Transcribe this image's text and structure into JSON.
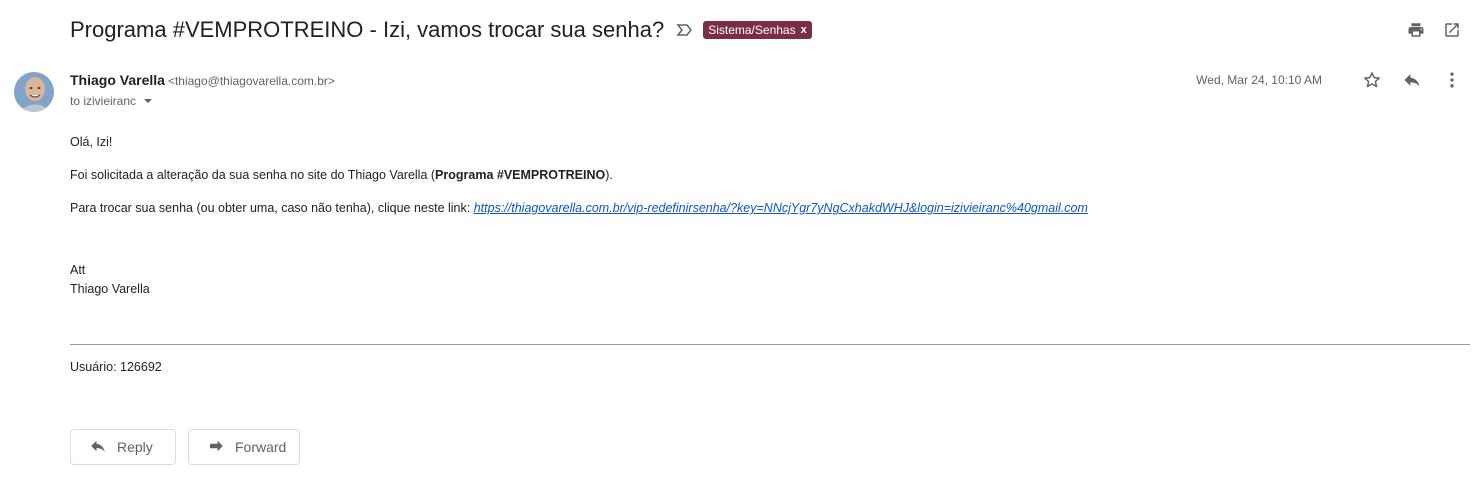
{
  "email": {
    "subject": "Programa #VEMPROTREINO - Izi, vamos trocar sua senha?",
    "label": "Sistema/Senhas",
    "label_close": "x",
    "sender_name": "Thiago Varella",
    "sender_email": "<thiago@thiagovarella.com.br>",
    "to_text": "to izivieiranc",
    "date": "Wed, Mar 24, 10:10 AM"
  },
  "body": {
    "greeting": "Olá, Izi!",
    "line1_prefix": "Foi solicitada a alteração da sua senha no site do Thiago Varella (",
    "line1_bold": "Programa #VEMPROTREINO",
    "line1_suffix": ").",
    "line2_prefix": "Para trocar sua senha (ou obter uma, caso não tenha), clique neste link:",
    "link": "https://thiagovarella.com.br/vip-redefinirsenha/?key=NNcjYgr7yNgCxhakdWHJ&login=izivieiranc%40gmail.com",
    "sig1": "Att",
    "sig2": "Thiago Varella",
    "user_line": "Usuário: 126692"
  },
  "actions": {
    "reply": "Reply",
    "forward": "Forward"
  },
  "icons": {
    "print": "print-icon",
    "open_new": "open-in-new-window-icon",
    "star": "star-icon",
    "reply": "reply-icon",
    "more": "more-vert-icon",
    "importance": "importance-marker-icon",
    "forward": "forward-icon"
  },
  "colors": {
    "label_bg": "#7b2d46",
    "link": "#1155cc",
    "icon": "#5f6368"
  }
}
